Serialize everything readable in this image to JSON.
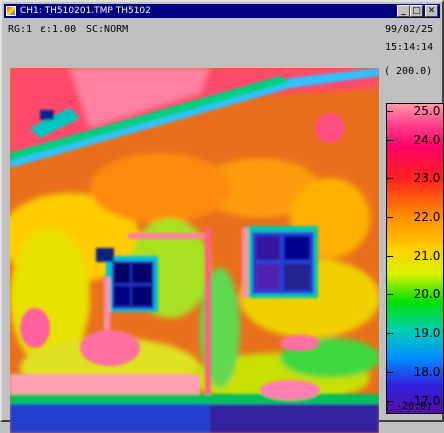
{
  "window": {
    "title": "CH1: TH510201.TMP   TH5102",
    "minimize_label": "_",
    "maximize_label": "□",
    "close_label": "✕",
    "icon": "thermal-app-icon"
  },
  "info": {
    "rg": "RG:1",
    "emissivity": "ε:1.00",
    "sc": "SC:NORM",
    "date": "99/02/25",
    "time": "15:14:14"
  },
  "scale": {
    "max_label": "( 200.0)",
    "min_label": "( -20.0)",
    "ticks": [
      "25.0",
      "24.0",
      "23.0",
      "22.0",
      "21.0",
      "20.0",
      "19.0",
      "18.0",
      "17.0"
    ]
  },
  "colors": {
    "titlebar": "#000080",
    "hot": "#ff2060",
    "warm": "#ff8c00",
    "mid": "#ffd000",
    "cool": "#00e000",
    "cold": "#3020e0"
  }
}
